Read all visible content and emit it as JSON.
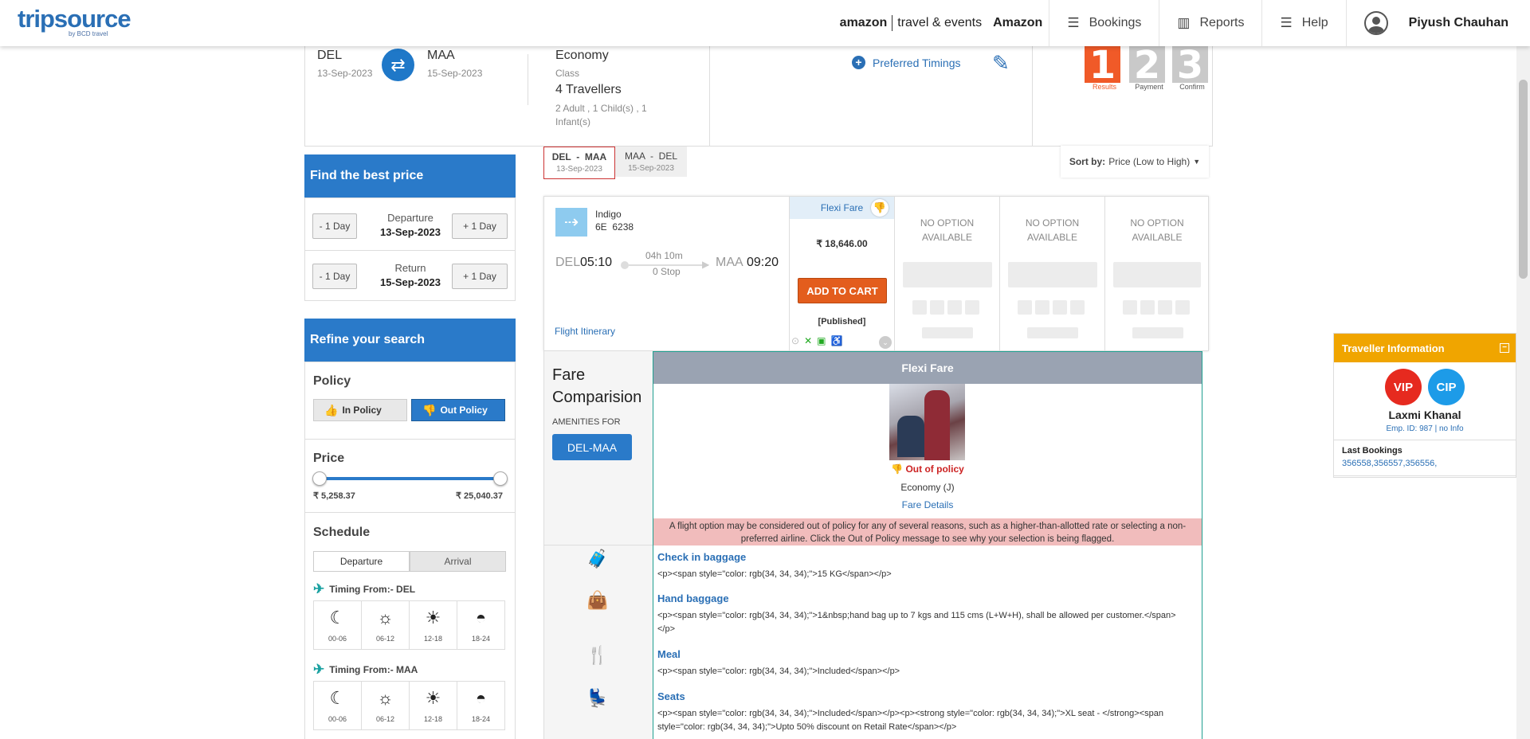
{
  "header": {
    "logo": "tripsource",
    "logo_sub": "by BCD travel",
    "amazon_brand": "amazon",
    "amazon_sub": "travel & events",
    "company": "Amazon",
    "nav": [
      {
        "label": "Bookings",
        "icon": "menu-icon"
      },
      {
        "label": "Reports",
        "icon": "chart-icon"
      },
      {
        "label": "Help",
        "icon": "menu-icon"
      }
    ],
    "user_name": "Piyush Chauhan"
  },
  "search": {
    "from_city": "DEL",
    "from_date": "13-Sep-2023",
    "to_city": "MAA",
    "to_date": "15-Sep-2023",
    "cabin": "Economy",
    "cabin_label": "Class",
    "travellers": "4 Travellers",
    "travellers_detail": "2 Adult , 1 Child(s) , 1 Infant(s)",
    "preferred_timings": "Preferred Timings"
  },
  "steps": [
    {
      "num": "1",
      "label": "Results",
      "active": true
    },
    {
      "num": "2",
      "label": "Payment",
      "active": false
    },
    {
      "num": "3",
      "label": "Confirm",
      "active": false
    }
  ],
  "best_price": {
    "title": "Find the best price",
    "minus": "- 1 Day",
    "plus": "+ 1 Day",
    "departure_label": "Departure",
    "departure_date": "13-Sep-2023",
    "return_label": "Return",
    "return_date": "15-Sep-2023"
  },
  "refine": {
    "title": "Refine your search",
    "policy_label": "Policy",
    "in_policy": "In Policy",
    "out_policy": "Out Policy",
    "price_label": "Price",
    "price_min": "₹ 5,258.37",
    "price_max": "₹ 25,040.37",
    "schedule_label": "Schedule",
    "tab_departure": "Departure",
    "tab_arrival": "Arrival",
    "timing_from_1": "Timing From:- DEL",
    "timing_from_2": "Timing From:- MAA",
    "slots": [
      "00-06",
      "06-12",
      "12-18",
      "18-24"
    ]
  },
  "route_tabs": [
    {
      "route": "DEL  -  MAA",
      "date": "13-Sep-2023"
    },
    {
      "route": "MAA  -  DEL",
      "date": "15-Sep-2023"
    }
  ],
  "sort": {
    "label": "Sort by:",
    "value": "Price (Low to High)"
  },
  "flight": {
    "airline": "Indigo",
    "flight_no": "6E  6238",
    "dep_city": "DEL",
    "dep_time": "05:10",
    "duration": "04h 10m",
    "stops": "0 Stop",
    "arr_city": "MAA",
    "arr_time": "09:20",
    "itinerary_link": "Flight Itinerary",
    "fare_name": "Flexi Fare",
    "price": "₹  18,646.00",
    "add_to_cart": "ADD TO CART",
    "fare_type": "[Published]",
    "no_option": "NO OPTION AVAILABLE"
  },
  "fare_comparison": {
    "title": "Fare Comparision",
    "amenities_for": "AMENITIES FOR",
    "route_btn": "DEL-MAA",
    "col_title": "Flexi Fare",
    "out_of_policy": "Out of policy",
    "cabin": "Economy (J)",
    "fare_details": "Fare Details",
    "warning": "A flight option may be considered out of policy for any of several reasons, such as a higher-than-allotted rate or selecting a non-preferred airline. Click the Out of Policy message to see why your selection is being flagged.",
    "amenities": [
      {
        "name": "Check in baggage",
        "text": "<p><span style=\"color: rgb(34, 34, 34);\">15 KG</span></p>",
        "icon": "suitcase-icon"
      },
      {
        "name": "Hand baggage",
        "text": "<p><span style=\"color: rgb(34, 34, 34);\">1&nbsp;hand bag up to 7 kgs and 115 cms (L+W+H), shall be allowed per customer.</span></p>",
        "icon": "bag-icon"
      },
      {
        "name": "Meal",
        "text": "<p><span style=\"color: rgb(34, 34, 34);\">Included</span></p>",
        "icon": "meal-icon"
      },
      {
        "name": "Seats",
        "text": "<p><span style=\"color: rgb(34, 34, 34);\">Included</span></p><p><strong style=\"color: rgb(34, 34, 34);\">XL seat - </strong><span style=\"color: rgb(34, 34, 34);\">Upto 50% discount on Retail Rate</span></p>",
        "icon": "seat-icon"
      }
    ]
  },
  "traveller": {
    "title": "Traveller Information",
    "badge_vip": "VIP",
    "badge_cip": "CIP",
    "name": "Laxmi Khanal",
    "emp": "Emp. ID: 987 | no Info",
    "last_bookings_label": "Last Bookings",
    "last_bookings": "356558,356557,356556,"
  },
  "colors": {
    "brand_blue": "#2a7ac9",
    "accent_orange": "#e35d1d",
    "policy_red": "#c22222",
    "traveller_yellow": "#f0a500"
  }
}
